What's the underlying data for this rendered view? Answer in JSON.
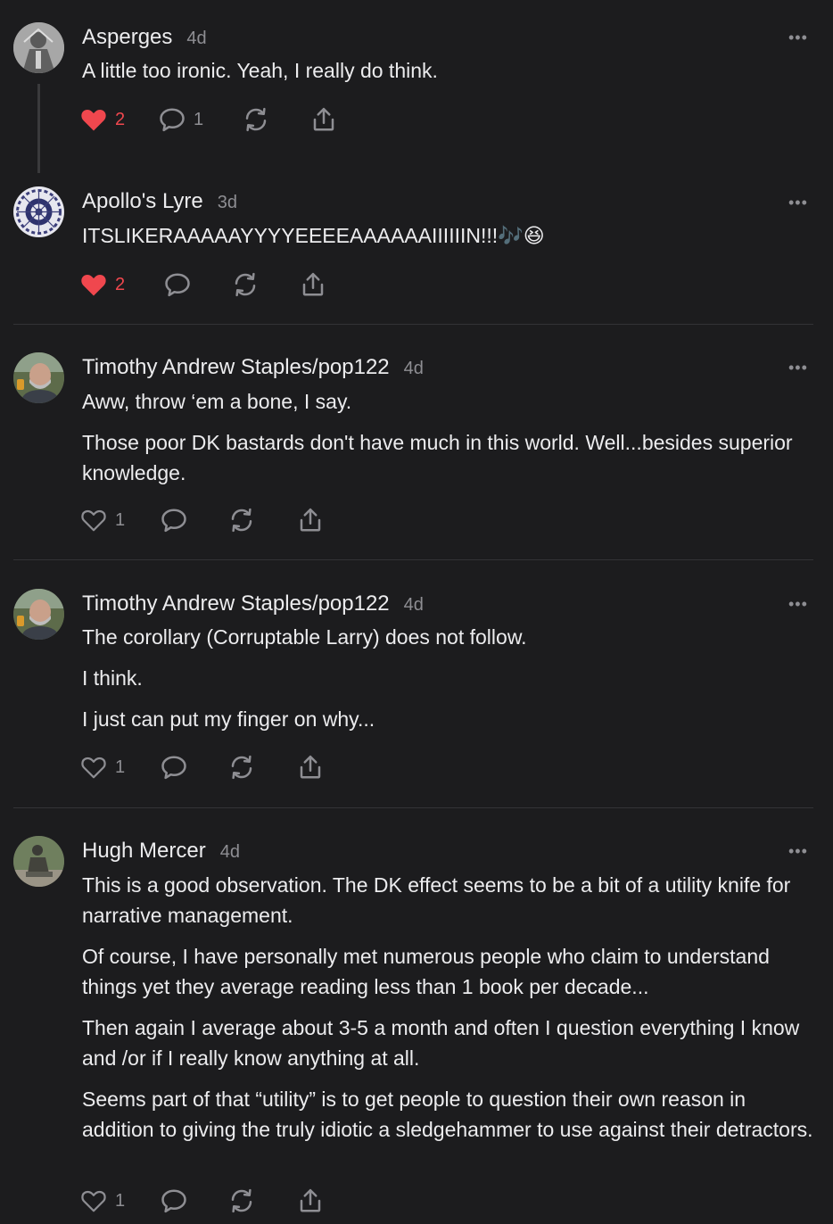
{
  "colors": {
    "background": "#1c1c1e",
    "text": "#ececee",
    "muted": "#8e8e93",
    "like_red": "#f0474e",
    "divider": "#333336"
  },
  "icons": {
    "like": "heart-icon",
    "reply": "speech-bubble-icon",
    "restack": "restack-arrows-icon",
    "share": "share-upload-icon",
    "more": "ellipsis-icon"
  },
  "comments": [
    {
      "author": "Asperges",
      "age": "4d",
      "more": "•••",
      "avatar": "icon-avatar",
      "paragraphs": [
        "A little too ironic. Yeah, I really do think."
      ],
      "likes": "2",
      "liked": true,
      "replies": "1"
    },
    {
      "author": "Apollo's Lyre",
      "age": "3d",
      "more": "•••",
      "avatar": "mandala-avatar",
      "paragraphs": [
        "ITSLIKERAAAAAYYYYEEEEAAAAAAIIIIIIN!!!🎶😆"
      ],
      "likes": "2",
      "liked": true,
      "replies": ""
    },
    {
      "author": "Timothy Andrew Staples/pop122",
      "age": "4d",
      "more": "•••",
      "avatar": "photo-avatar",
      "paragraphs": [
        "Aww, throw ‘em a bone, I say.",
        "Those poor DK bastards don't have much in this world. Well...besides superior knowledge."
      ],
      "likes": "1",
      "liked": false,
      "replies": ""
    },
    {
      "author": "Timothy Andrew Staples/pop122",
      "age": "4d",
      "more": "•••",
      "avatar": "photo-avatar",
      "paragraphs": [
        "The corollary (Corruptable Larry) does not follow.",
        "I think.",
        "I just can put my finger on why..."
      ],
      "likes": "1",
      "liked": false,
      "replies": ""
    },
    {
      "author": "Hugh Mercer",
      "age": "4d",
      "more": "•••",
      "avatar": "statue-avatar",
      "paragraphs": [
        "This is a good observation. The DK effect seems to be a bit of a utility knife for narrative management.",
        "Of course, I have personally met numerous people who claim to understand things yet they average reading less than 1 book per decade...",
        "Then again I average about 3-5 a month and often I question everything I know and /or if I really know anything at all.",
        "Seems part of that “utility” is to get people to question their own reason in addition to giving the truly idiotic a sledgehammer to use against their detractors."
      ],
      "likes": "1",
      "liked": false,
      "replies": ""
    }
  ]
}
